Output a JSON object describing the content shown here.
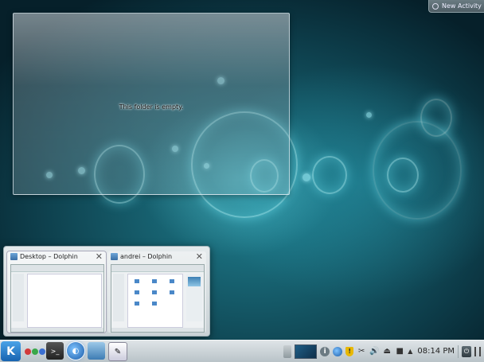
{
  "top_right": {
    "new_activity_label": "New Activity"
  },
  "folder_view": {
    "empty_message": "This folder is empty."
  },
  "window_switcher": {
    "windows": [
      {
        "title": "Desktop – Dolphin",
        "selected": true
      },
      {
        "title": "andrei – Dolphin",
        "selected": false
      }
    ]
  },
  "panel": {
    "kmenu_glyph": "K",
    "tasks": [
      "terminal-icon",
      "dolphin-icon",
      "stack-icon",
      "text-editor-icon"
    ],
    "clock": "08:14 PM",
    "colors": {
      "pager_red": "#d23a3a",
      "pager_green": "#3aa84a",
      "pager_blue": "#3a6fd2"
    }
  }
}
